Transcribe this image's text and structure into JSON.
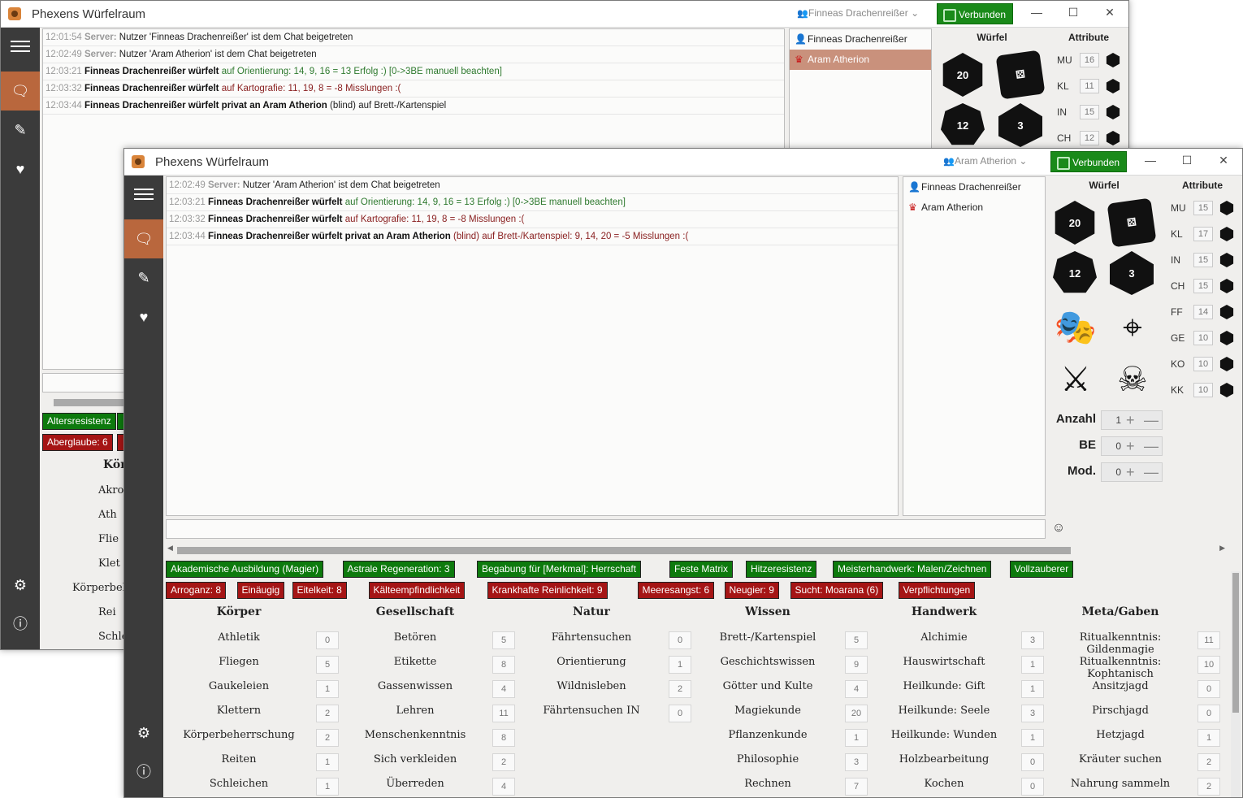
{
  "app": {
    "title": "Phexens Würfelraum"
  },
  "back": {
    "user_select": "Finneas Drachenreißer",
    "connected": "Verbunden",
    "chat": [
      {
        "time": "12:01:54",
        "kind": "server",
        "prefix": "Server:",
        "text": " Nutzer 'Finneas Drachenreißer' ist dem Chat beigetreten"
      },
      {
        "time": "12:02:49",
        "kind": "server",
        "prefix": "Server:",
        "text": " Nutzer 'Aram Atherion' ist dem Chat beigetreten"
      },
      {
        "time": "12:03:21",
        "kind": "roll",
        "name": "Finneas Drachenreißer würfelt",
        "tail": " auf Orientierung: 14, 9, 16 = 13 Erfolg :)  [0->3BE manuell beachten]",
        "tone": "g"
      },
      {
        "time": "12:03:32",
        "kind": "roll",
        "name": "Finneas Drachenreißer würfelt",
        "tail": " auf Kartografie: 11, 19, 8 = -8 Misslungen :(",
        "tone": "r"
      },
      {
        "time": "12:03:44",
        "kind": "roll",
        "name": "Finneas Drachenreißer würfelt privat an Aram Atherion",
        "tail": " (blind) auf Brett-/Kartenspiel",
        "tone": ""
      }
    ],
    "users": [
      "Finneas Drachenreißer",
      "Aram Atherion"
    ],
    "attr_header": "Attribute",
    "dice_header": "Würfel",
    "attributes": [
      {
        "label": "MU",
        "value": "16"
      },
      {
        "label": "KL",
        "value": "11"
      },
      {
        "label": "IN",
        "value": "15"
      },
      {
        "label": "CH",
        "value": "12"
      }
    ],
    "tag1": "Altersresistenz",
    "tag2": "Aberglaube: 6",
    "cut_labels": [
      "Kör",
      "Akro",
      "Ath",
      "Flie",
      "Klet",
      "Körperbeh",
      "Rei",
      "Schle"
    ]
  },
  "front": {
    "user_select": "Aram Atherion",
    "connected": "Verbunden",
    "chat": [
      {
        "time": "12:02:49",
        "kind": "server",
        "prefix": "Server:",
        "text": " Nutzer 'Aram Atherion' ist dem Chat beigetreten"
      },
      {
        "time": "12:03:21",
        "kind": "roll",
        "name": "Finneas Drachenreißer würfelt",
        "tail": " auf Orientierung: 14, 9, 16 = 13 Erfolg :)  [0->3BE manuell beachten]",
        "tone": "g"
      },
      {
        "time": "12:03:32",
        "kind": "roll",
        "name": "Finneas Drachenreißer würfelt",
        "tail": " auf Kartografie: 11, 19, 8 = -8 Misslungen :(",
        "tone": "r"
      },
      {
        "time": "12:03:44",
        "kind": "roll",
        "name": "Finneas Drachenreißer würfelt privat an Aram Atherion",
        "tail": " (blind) auf Brett-/Kartenspiel: 9, 14, 20 = -5 Misslungen :(",
        "tone": "r"
      }
    ],
    "users": [
      "Finneas Drachenreißer",
      "Aram Atherion"
    ],
    "dice_header": "Würfel",
    "attr_header": "Attribute",
    "dice": [
      {
        "kind": "d20",
        "label": "20"
      },
      {
        "kind": "d6",
        "label": "⚄"
      },
      {
        "kind": "d12",
        "label": "12"
      },
      {
        "kind": "d4",
        "label": "3"
      }
    ],
    "attributes": [
      {
        "label": "MU",
        "value": "15"
      },
      {
        "label": "KL",
        "value": "17"
      },
      {
        "label": "IN",
        "value": "15"
      },
      {
        "label": "CH",
        "value": "15"
      },
      {
        "label": "FF",
        "value": "14"
      },
      {
        "label": "GE",
        "value": "10"
      },
      {
        "label": "KO",
        "value": "10"
      },
      {
        "label": "KK",
        "value": "10"
      }
    ],
    "spinners": [
      {
        "label": "Anzahl",
        "value": "1"
      },
      {
        "label": "BE",
        "value": "0"
      },
      {
        "label": "Mod.",
        "value": "0"
      }
    ],
    "advantages": [
      "Akademische Ausbildung (Magier)",
      "Astrale Regeneration: 3",
      "Begabung für [Merkmal]: Herrschaft",
      "Feste Matrix",
      "Hitzeresistenz",
      "Meisterhandwerk: Malen/Zeichnen",
      "Vollzauberer"
    ],
    "disadvantages": [
      "Arroganz: 8",
      "Einäugig",
      "Eitelkeit: 8",
      "Kälteempfindlichkeit",
      "Krankhafte Reinlichkeit: 9",
      "Meeresangst: 6",
      "Neugier: 9",
      "Sucht: Moarana (6)",
      "Verpflichtungen"
    ],
    "categories": [
      {
        "title": "Körper",
        "skills": [
          {
            "n": "Athletik",
            "v": "0"
          },
          {
            "n": "Fliegen",
            "v": "5"
          },
          {
            "n": "Gaukeleien",
            "v": "1"
          },
          {
            "n": "Klettern",
            "v": "2"
          },
          {
            "n": "Körperbeherrschung",
            "v": "2"
          },
          {
            "n": "Reiten",
            "v": "1"
          },
          {
            "n": "Schleichen",
            "v": "1"
          }
        ]
      },
      {
        "title": "Gesellschaft",
        "skills": [
          {
            "n": "Betören",
            "v": "5"
          },
          {
            "n": "Etikette",
            "v": "8"
          },
          {
            "n": "Gassenwissen",
            "v": "4"
          },
          {
            "n": "Lehren",
            "v": "11"
          },
          {
            "n": "Menschenkenntnis",
            "v": "8"
          },
          {
            "n": "Sich verkleiden",
            "v": "2"
          },
          {
            "n": "Überreden",
            "v": "4"
          }
        ]
      },
      {
        "title": "Natur",
        "skills": [
          {
            "n": "Fährtensuchen",
            "v": "0"
          },
          {
            "n": "Orientierung",
            "v": "1"
          },
          {
            "n": "Wildnisleben",
            "v": "2"
          },
          {
            "n": "Fährtensuchen IN",
            "v": "0"
          }
        ]
      },
      {
        "title": "Wissen",
        "skills": [
          {
            "n": "Brett-/Kartenspiel",
            "v": "5"
          },
          {
            "n": "Geschichtswissen",
            "v": "9"
          },
          {
            "n": "Götter und Kulte",
            "v": "4"
          },
          {
            "n": "Magiekunde",
            "v": "20"
          },
          {
            "n": "Pflanzenkunde",
            "v": "1"
          },
          {
            "n": "Philosophie",
            "v": "3"
          },
          {
            "n": "Rechnen",
            "v": "7"
          }
        ]
      },
      {
        "title": "Handwerk",
        "skills": [
          {
            "n": "Alchimie",
            "v": "3"
          },
          {
            "n": "Hauswirtschaft",
            "v": "1"
          },
          {
            "n": "Heilkunde: Gift",
            "v": "1"
          },
          {
            "n": "Heilkunde: Seele",
            "v": "3"
          },
          {
            "n": "Heilkunde: Wunden",
            "v": "1"
          },
          {
            "n": "Holzbearbeitung",
            "v": "0"
          },
          {
            "n": "Kochen",
            "v": "0"
          }
        ]
      },
      {
        "title": "Meta/Gaben",
        "skills": [
          {
            "n": "Ritualkenntnis: Gildenmagie",
            "v": "11"
          },
          {
            "n": "Ritualkenntnis: Kophtanisch",
            "v": "10"
          },
          {
            "n": "Ansitzjagd",
            "v": "0"
          },
          {
            "n": "Pirschjagd",
            "v": "0"
          },
          {
            "n": "Hetzjagd",
            "v": "1"
          },
          {
            "n": "Kräuter suchen",
            "v": "2"
          },
          {
            "n": "Nahrung sammeln",
            "v": "2"
          }
        ]
      }
    ]
  }
}
